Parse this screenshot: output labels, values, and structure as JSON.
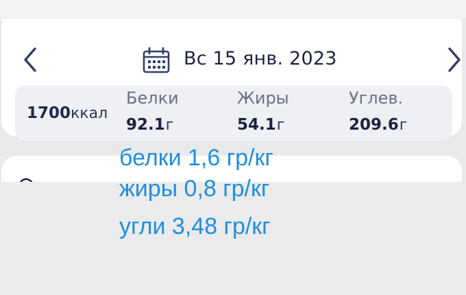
{
  "header": {
    "date": "Вс 15 янв. 2023",
    "prev_icon": "chevron-left-icon",
    "next_icon": "chevron-right-icon",
    "calendar_icon": "calendar-icon"
  },
  "summary": {
    "calories_value": "1700",
    "calories_unit": "ккал",
    "macros": [
      {
        "label": "Белки",
        "value": "92.1",
        "unit": "г"
      },
      {
        "label": "Жиры",
        "value": "54.1",
        "unit": "г"
      },
      {
        "label": "Углев.",
        "value": "209.6",
        "unit": "г"
      }
    ]
  },
  "annotations": [
    "белки 1,6 гр/кг",
    "жиры 0,8 гр/кг",
    "угли 3,48 гр/кг"
  ],
  "colors": {
    "accent": "#2f3d6b",
    "annotation": "#1e8fe0",
    "card": "#ffffff",
    "summary_bg": "#eef0f4"
  }
}
